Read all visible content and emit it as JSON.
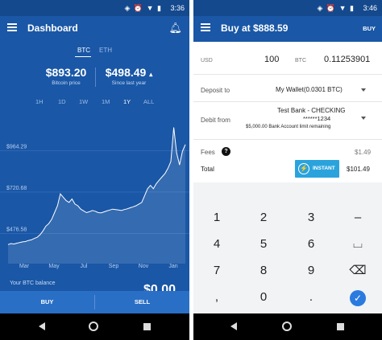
{
  "status": {
    "time_left": "3:36",
    "time_right": "3:46",
    "icons": "◈ ⏰ ▼ ▮"
  },
  "dashboard": {
    "title": "Dashboard",
    "coins": [
      "BTC",
      "ETH"
    ],
    "bitcoin_price": "$893.20",
    "bitcoin_price_label": "Bitcoin price",
    "since_last_year": "$498.49",
    "since_last_year_arrow": "▴",
    "since_last_year_label": "Since last year",
    "ranges": [
      "1H",
      "1D",
      "1W",
      "1M",
      "1Y",
      "ALL"
    ],
    "active_range": "1Y",
    "balance_label": "Your BTC balance",
    "balance_value": "$0.00",
    "buy_label": "BUY",
    "sell_label": "SELL"
  },
  "chart_data": {
    "type": "area",
    "x": [
      "Mar",
      "May",
      "Jul",
      "Sep",
      "Nov",
      "Jan"
    ],
    "y_ticks": [
      "$964.29",
      "$720.68",
      "$476.58"
    ],
    "y_tick_values": [
      964.29,
      720.68,
      476.58
    ],
    "ylim": [
      300,
      1150
    ],
    "values": [
      412,
      418,
      415,
      420,
      424,
      428,
      430,
      436,
      440,
      448,
      455,
      470,
      492,
      520,
      535,
      560,
      600,
      640,
      710,
      690,
      670,
      660,
      680,
      650,
      640,
      620,
      610,
      600,
      605,
      612,
      608,
      600,
      598,
      604,
      610,
      615,
      620,
      618,
      615,
      612,
      618,
      622,
      628,
      634,
      640,
      650,
      660,
      700,
      740,
      760,
      740,
      770,
      790,
      810,
      830,
      860,
      900,
      1100,
      950,
      880,
      960,
      1000
    ],
    "grid": true
  },
  "buy": {
    "title": "Buy at $888.59",
    "action": "BUY",
    "usd_label": "USD",
    "usd_value": "100",
    "btc_label": "BTC",
    "btc_value": "0.11253901",
    "deposit_label": "Deposit to",
    "deposit_value": "My Wallet(0.0301 BTC)",
    "debit_label": "Debit from",
    "debit_bank": "Test Bank - CHECKING",
    "debit_account": "******1234",
    "debit_limit": "$5,000.00 Bank Account limit remaining",
    "fees_label": "Fees",
    "fees_help": "?",
    "fees_value": "$1.49",
    "total_label": "Total",
    "instant_label": "INSTANT",
    "instant_icon": "⚡",
    "total_value": "$101.49"
  },
  "keypad": {
    "keys": [
      "1",
      "2",
      "3",
      "–",
      "4",
      "5",
      "6",
      "⌴",
      "7",
      "8",
      "9",
      "⌫",
      ",",
      "0",
      ".",
      "✓"
    ]
  }
}
